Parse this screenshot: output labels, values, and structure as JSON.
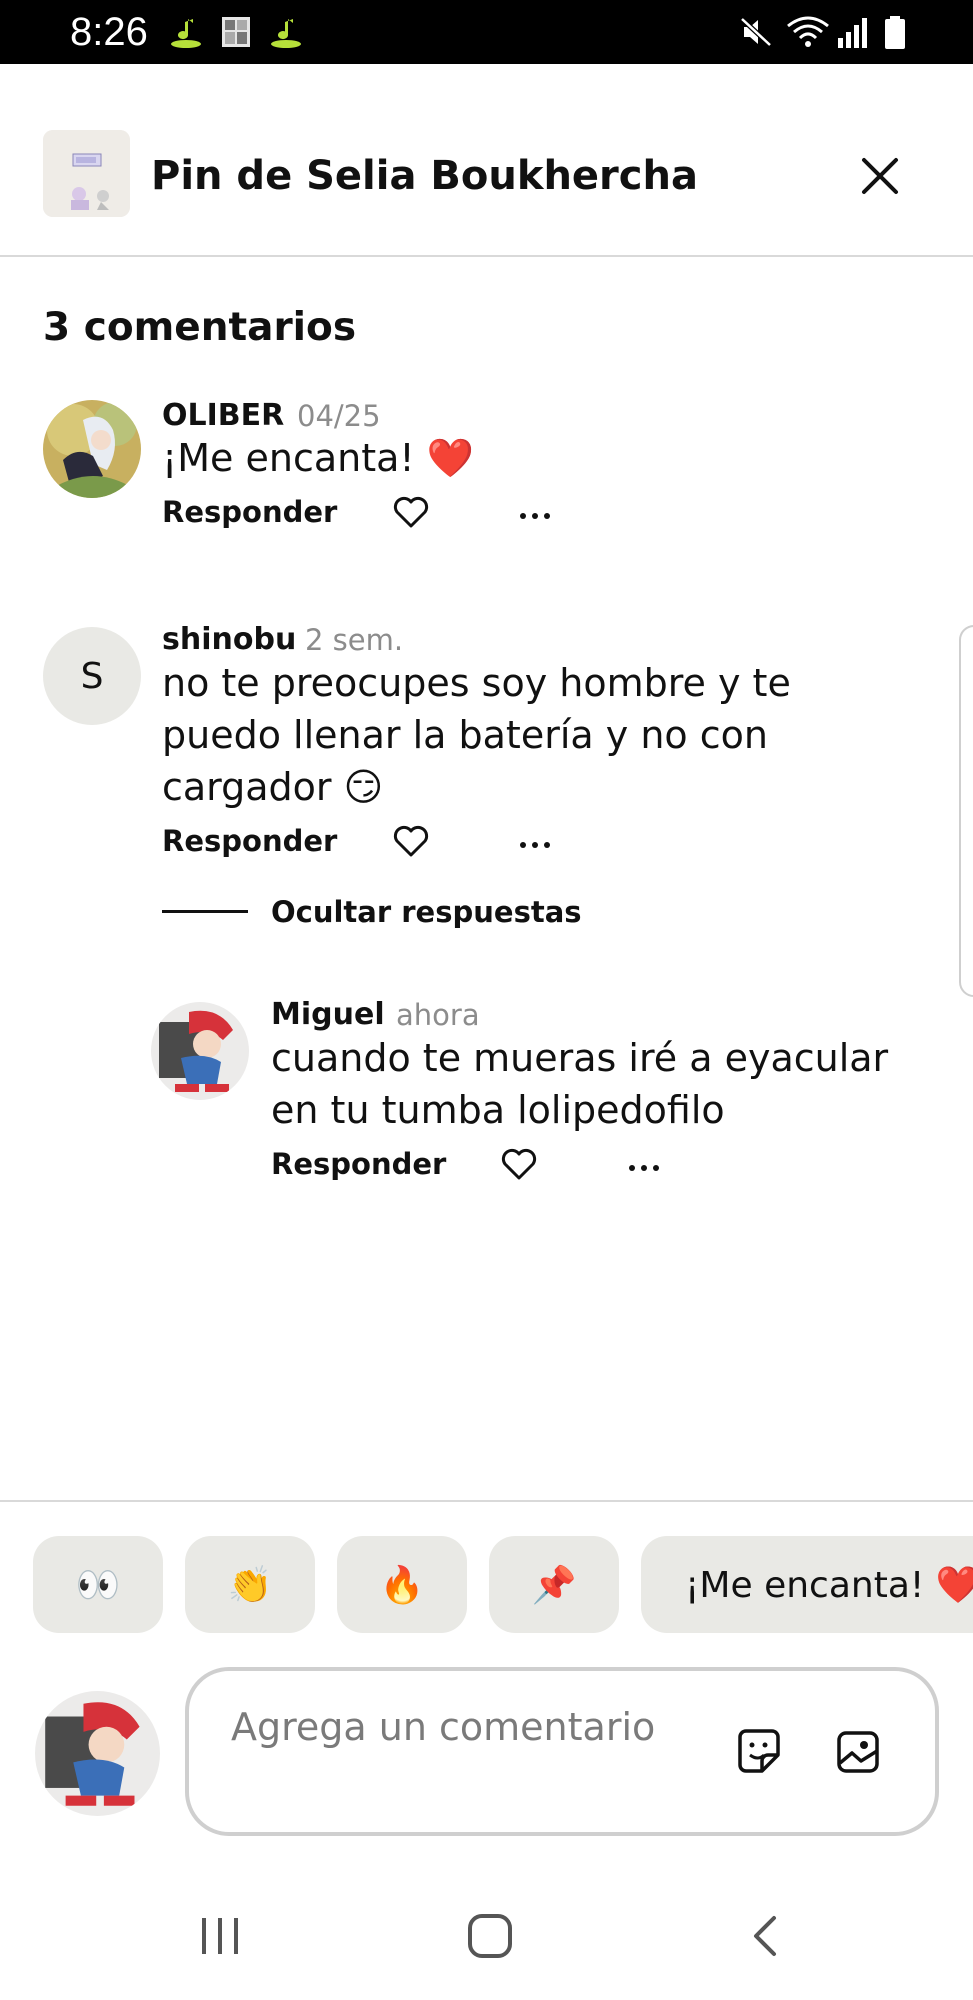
{
  "status_bar": {
    "time": "8:26",
    "left_icons": [
      "music-notification-icon",
      "gallery-notification-icon",
      "music-notification-icon"
    ],
    "right_icons": [
      "mute-icon",
      "wifi-icon",
      "signal-icon",
      "battery-icon"
    ]
  },
  "header": {
    "title": "Pin de Selia Boukhercha",
    "close_icon": "close-icon"
  },
  "comments_count": "3 comentarios",
  "comments": [
    {
      "name": "OLIBER",
      "time": "04/25",
      "text": "¡Me encanta! ❤️",
      "reply_label": "Responder"
    },
    {
      "name": "shinobu",
      "time": "2 sem.",
      "avatar_initial": "S",
      "text_line1": "no te preocupes soy hombre y te",
      "text_line2": "puedo llenar la batería y no con",
      "text_line3": "cargador 😏",
      "reply_label": "Responder",
      "hide_replies_label": "Ocultar respuestas",
      "replies": [
        {
          "name": "Miguel",
          "time": "ahora",
          "text_line1": "cuando te mueras iré a eyacular",
          "text_line2": "en tu tumba lolipedofilo",
          "reply_label": "Responder"
        }
      ]
    }
  ],
  "reactions": [
    {
      "label": "👀"
    },
    {
      "label": "👏"
    },
    {
      "label": "🔥"
    },
    {
      "label": "📌"
    },
    {
      "label": "¡Me encanta! ❤️"
    }
  ],
  "composer": {
    "placeholder": "Agrega un comentario",
    "sticker_icon": "sticker-icon",
    "image_icon": "image-icon"
  },
  "nav_bar": {
    "buttons": [
      "recent-apps-icon",
      "home-icon",
      "back-icon"
    ]
  },
  "colors": {
    "chip_background": "#e9e9e5",
    "muted_text": "#8c8c8c",
    "divider": "#d9d9d9"
  }
}
